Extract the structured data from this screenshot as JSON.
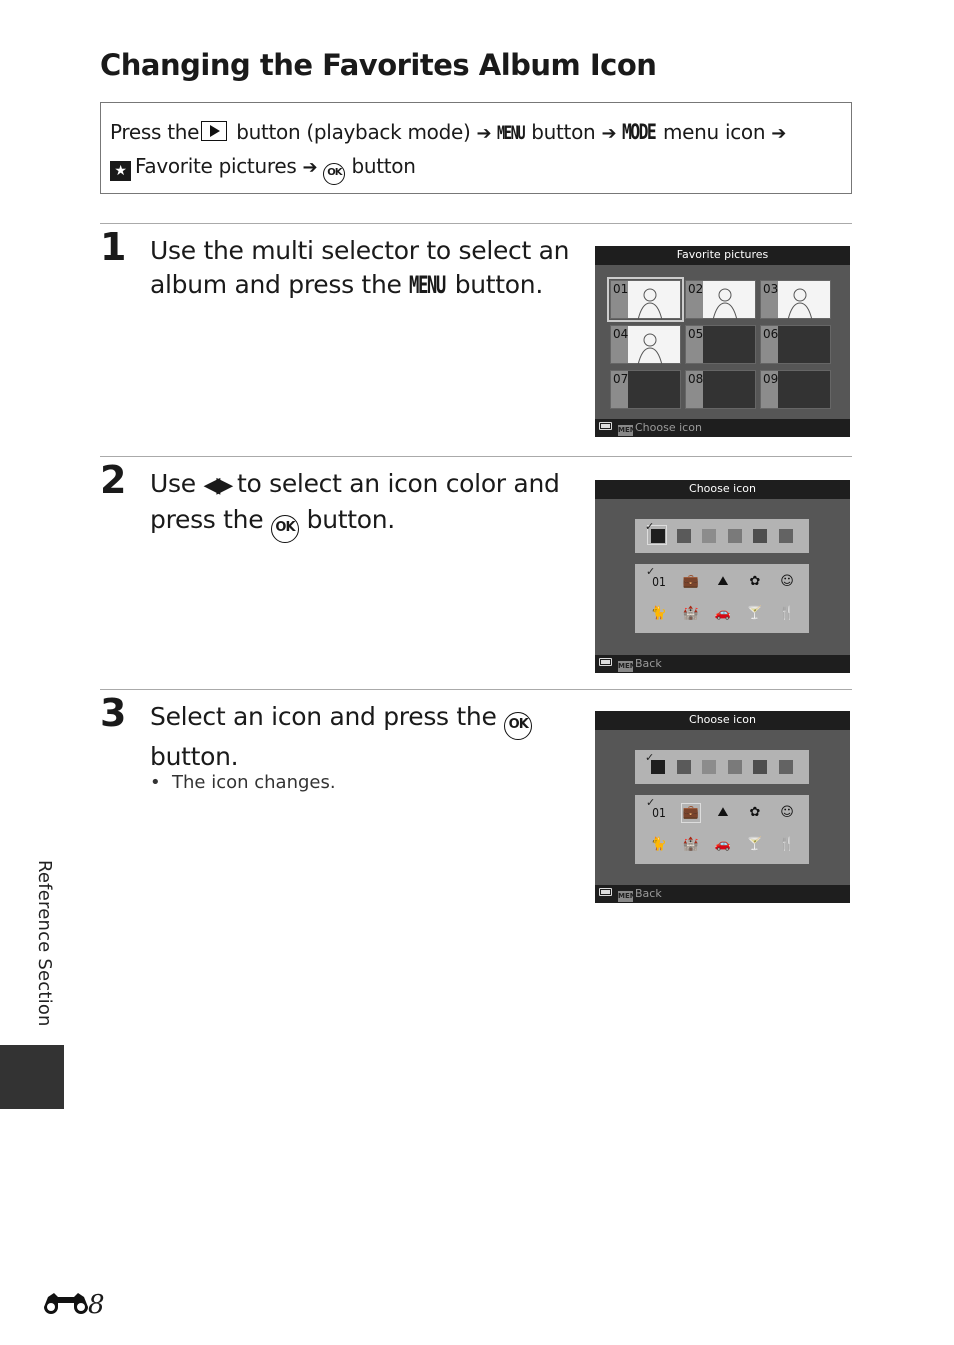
{
  "page": {
    "title": "Changing the Favorites Album Icon",
    "side_label": "Reference Section",
    "page_number": "8",
    "page_prefix_icon": "binoculars-icon"
  },
  "procedure": {
    "press_the": "Press the",
    "playback_icon": "playback-button-icon",
    "button_playback": "button (playback mode)",
    "menu_glyph": "MENU",
    "button": "button",
    "mode_glyph": "MODE",
    "menu_icon": "menu icon",
    "favorite_icon": "★",
    "favorite_pictures": "Favorite pictures",
    "ok_glyph": "OK",
    "button_end": "button",
    "arrow": "➔"
  },
  "steps": [
    {
      "number": "1",
      "text_before": "Use the multi selector to select an album and press the",
      "glyph": "MENU",
      "text_after": "button."
    },
    {
      "number": "2",
      "text_before": "Use",
      "arrows": "◀▶",
      "text_mid": "to select an icon color and press the",
      "glyph": "OK",
      "text_after": "button."
    },
    {
      "number": "3",
      "text_before": "Select an icon and press the",
      "glyph": "OK",
      "text_after": "button.",
      "bullets": [
        "The icon changes."
      ]
    }
  ],
  "screens": {
    "favorites": {
      "header": "Favorite pictures",
      "footer_menu": "MENU",
      "footer_label": "Choose icon",
      "selected_album": "01",
      "albums": [
        {
          "num": "01",
          "has_photo": true
        },
        {
          "num": "02",
          "has_photo": true
        },
        {
          "num": "03",
          "has_photo": true
        },
        {
          "num": "04",
          "has_photo": true
        },
        {
          "num": "05",
          "has_photo": false
        },
        {
          "num": "06",
          "has_photo": false
        },
        {
          "num": "07",
          "has_photo": false
        },
        {
          "num": "08",
          "has_photo": false
        },
        {
          "num": "09",
          "has_photo": false
        }
      ]
    },
    "choose_icon_color": {
      "header": "Choose icon",
      "footer_menu": "MENU",
      "footer_label": "Back",
      "swatches": [
        "#1e1e1e",
        "#5a5a5a",
        "#8c8c8c",
        "#7a7a7a",
        "#4e4e4e",
        "#636363"
      ],
      "selected_swatch": 0,
      "checked_swatch": 0,
      "icons": [
        "01",
        "suitcase",
        "mountain",
        "flower",
        "child",
        "pet",
        "building",
        "car",
        "cocktail",
        "utensils"
      ],
      "icon_glyphs": [
        "01",
        "💼",
        "⛰",
        "✿",
        "☺",
        "🐈",
        "🏰",
        "🚗",
        "🍸",
        "🍴"
      ],
      "checked_icon": 0,
      "selected_icon": -1
    },
    "choose_icon_select": {
      "header": "Choose icon",
      "footer_menu": "MENU",
      "footer_label": "Back",
      "checked_swatch": 0,
      "checked_icon": 0,
      "selected_icon": 1
    }
  }
}
